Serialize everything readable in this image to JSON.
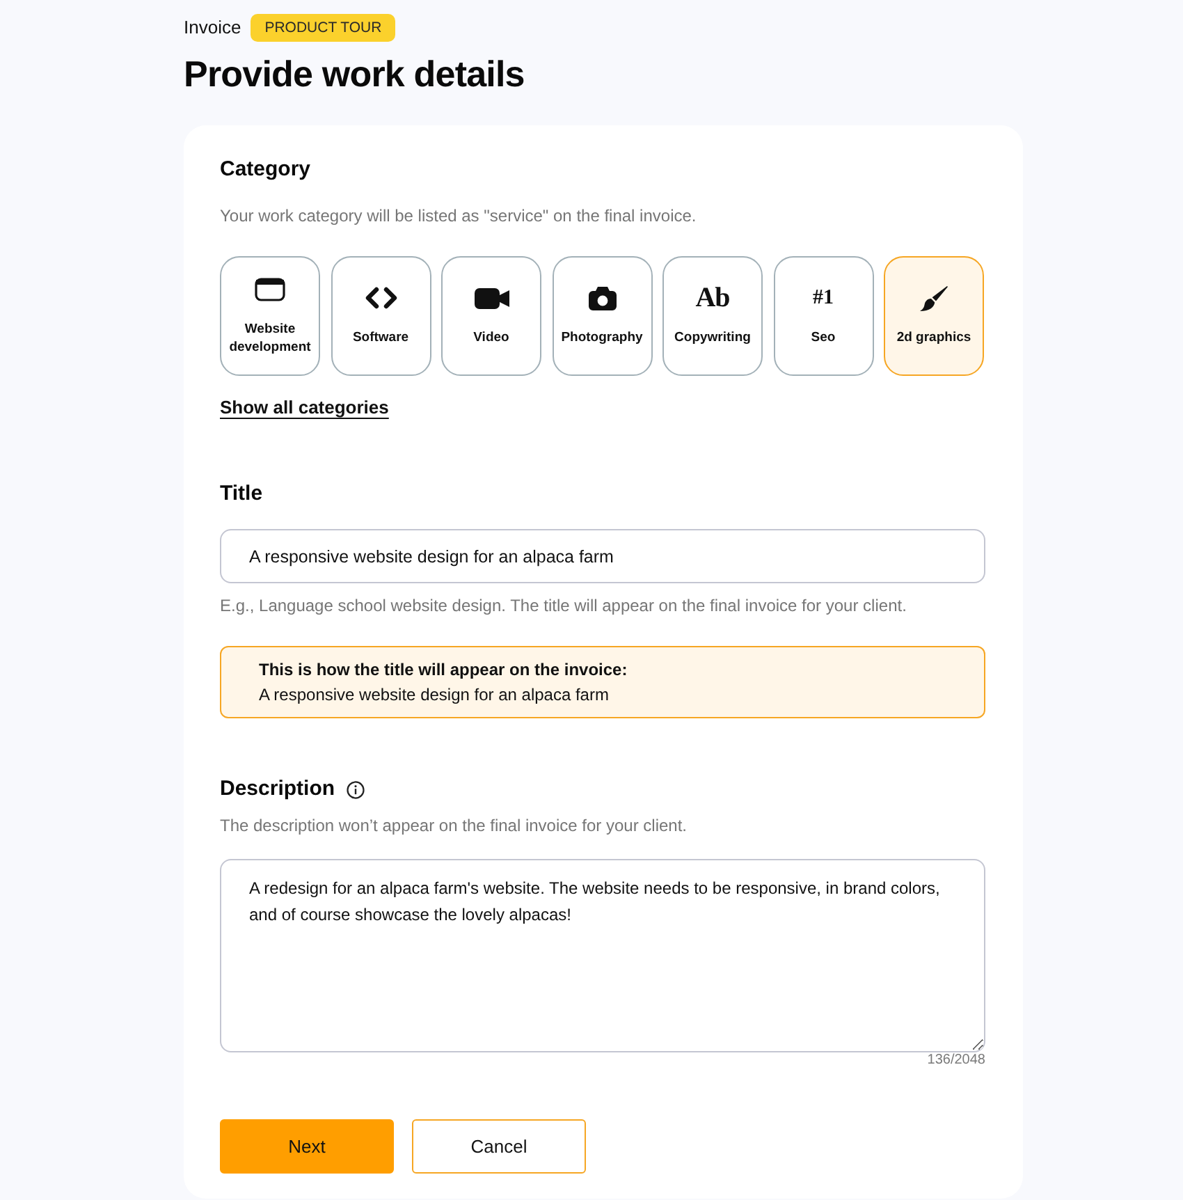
{
  "header": {
    "breadcrumb": "Invoice",
    "badge": "PRODUCT TOUR",
    "title": "Provide work details"
  },
  "category": {
    "label": "Category",
    "help": "Your work category will be listed as \"service\" on the final invoice.",
    "options": [
      {
        "label": "Website development",
        "kind": "window",
        "selected": false
      },
      {
        "label": "Software",
        "kind": "code",
        "selected": false
      },
      {
        "label": "Video",
        "kind": "video",
        "selected": false
      },
      {
        "label": "Photography",
        "kind": "camera",
        "selected": false
      },
      {
        "label": "Copywriting",
        "kind": "letters",
        "glyph": "Ab",
        "selected": false
      },
      {
        "label": "Seo",
        "kind": "rank",
        "glyph": "#1",
        "selected": false
      },
      {
        "label": "2d graphics",
        "kind": "brush",
        "selected": true
      }
    ],
    "link": "Show all categories"
  },
  "title_field": {
    "label": "Title",
    "value": "A responsive website design for an alpaca farm",
    "help": "E.g., Language school website design. The title will appear on the final invoice for your client.",
    "preview": {
      "heading": "This is how the title will appear on the invoice:",
      "text": "A responsive website design for an alpaca farm"
    }
  },
  "description": {
    "label": "Description",
    "help": "The description won’t appear on the final invoice for your client.",
    "value": "A redesign for an alpaca farm's website. The website needs to be responsive, in brand colors, and of course showcase the lovely alpacas!",
    "counter": "136/2048"
  },
  "buttons": [
    {
      "label": "Next",
      "kind": "primary"
    },
    {
      "label": "Cancel",
      "kind": "secondary"
    }
  ]
}
